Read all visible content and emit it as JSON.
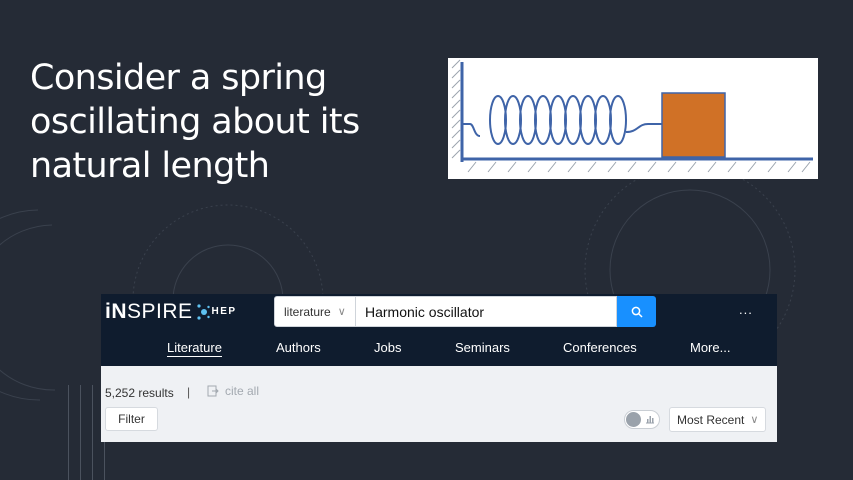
{
  "slide": {
    "title": "Consider a spring\noscillating about its\nnatural length"
  },
  "figure": {
    "block_color": "#d07126",
    "spring_color": "#3f64a8"
  },
  "inspire": {
    "logo": {
      "main_prefix": "iN",
      "main_suffix": "SPIRE",
      "sub": "HEP"
    },
    "search": {
      "scope": "literature",
      "query": "Harmonic oscillator",
      "button_icon": "search-icon"
    },
    "more_menu": "...",
    "nav": {
      "items": [
        {
          "label": "Literature",
          "active": true
        },
        {
          "label": "Authors"
        },
        {
          "label": "Jobs"
        },
        {
          "label": "Seminars"
        },
        {
          "label": "Conferences"
        },
        {
          "label": "More..."
        }
      ]
    },
    "results": {
      "count": "5,252 results",
      "separator": "|",
      "cite_all": "cite all",
      "filter": "Filter",
      "sort": "Most Recent",
      "citation_summary_toggle": false
    },
    "colors": {
      "header": "#0f1c2e",
      "accent": "#1890ff",
      "results_bar": "#eff1f4"
    }
  }
}
